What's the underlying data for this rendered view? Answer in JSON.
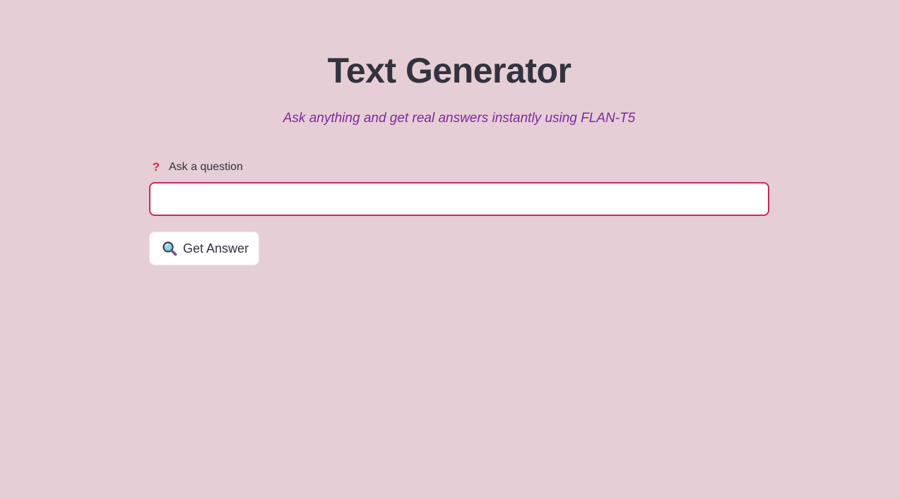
{
  "header": {
    "title": "Text Generator",
    "subtitle": "Ask anything and get real answers instantly using FLAN-T5"
  },
  "question_field": {
    "icon": "question-mark-icon",
    "icon_glyph": "?",
    "label": "Ask a question",
    "value": "",
    "placeholder": ""
  },
  "submit_button": {
    "icon": "magnifier-icon",
    "label": "Get Answer"
  },
  "colors": {
    "background": "#e6ced6",
    "title": "#31333f",
    "subtitle": "#7b2a9a",
    "input_border": "#d02660",
    "question_icon": "#e3264f"
  }
}
